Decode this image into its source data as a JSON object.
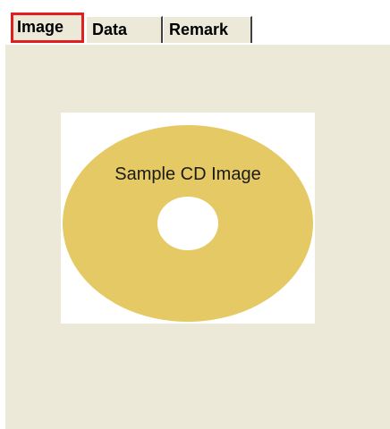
{
  "tabs": [
    {
      "label": "Image",
      "selected": true
    },
    {
      "label": "Data",
      "selected": false
    },
    {
      "label": "Remark",
      "selected": false
    }
  ],
  "image_panel": {
    "disc_caption": "Sample CD Image",
    "disc_color": "#e5c964"
  },
  "colors": {
    "panel_bg": "#ece9d8",
    "selected_tab_border": "#e02020"
  }
}
